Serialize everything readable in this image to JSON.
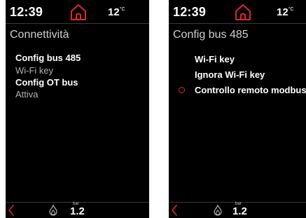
{
  "left_screen": {
    "time": "12:39",
    "temperature": "12",
    "temperature_unit": "°C",
    "title": "Connettività",
    "menu": [
      {
        "label": "Config bus 485"
      },
      {
        "label": "Wi-Fi key"
      },
      {
        "label": "Config OT bus"
      },
      {
        "label": "Attiva"
      }
    ],
    "pressure_unit": "bar",
    "pressure_value": "1.2"
  },
  "right_screen": {
    "time": "12:39",
    "temperature": "12",
    "temperature_unit": "°C",
    "title": "Config bus 485",
    "options": [
      {
        "label": "Wi-Fi key",
        "selected": false
      },
      {
        "label": "Ignora Wi-Fi key",
        "selected": false
      },
      {
        "label": "Controllo remoto modbus",
        "selected": true
      }
    ],
    "pressure_unit": "bar",
    "pressure_value": "1.2"
  },
  "icons": {
    "home": "home-icon",
    "back": "chevron-left-icon",
    "flame": "flame-icon",
    "radio": "radio-icon"
  },
  "colors": {
    "accent": "#e0262b",
    "background": "#000000",
    "text": "#ffffff",
    "text_dim": "#b0b0b0"
  }
}
